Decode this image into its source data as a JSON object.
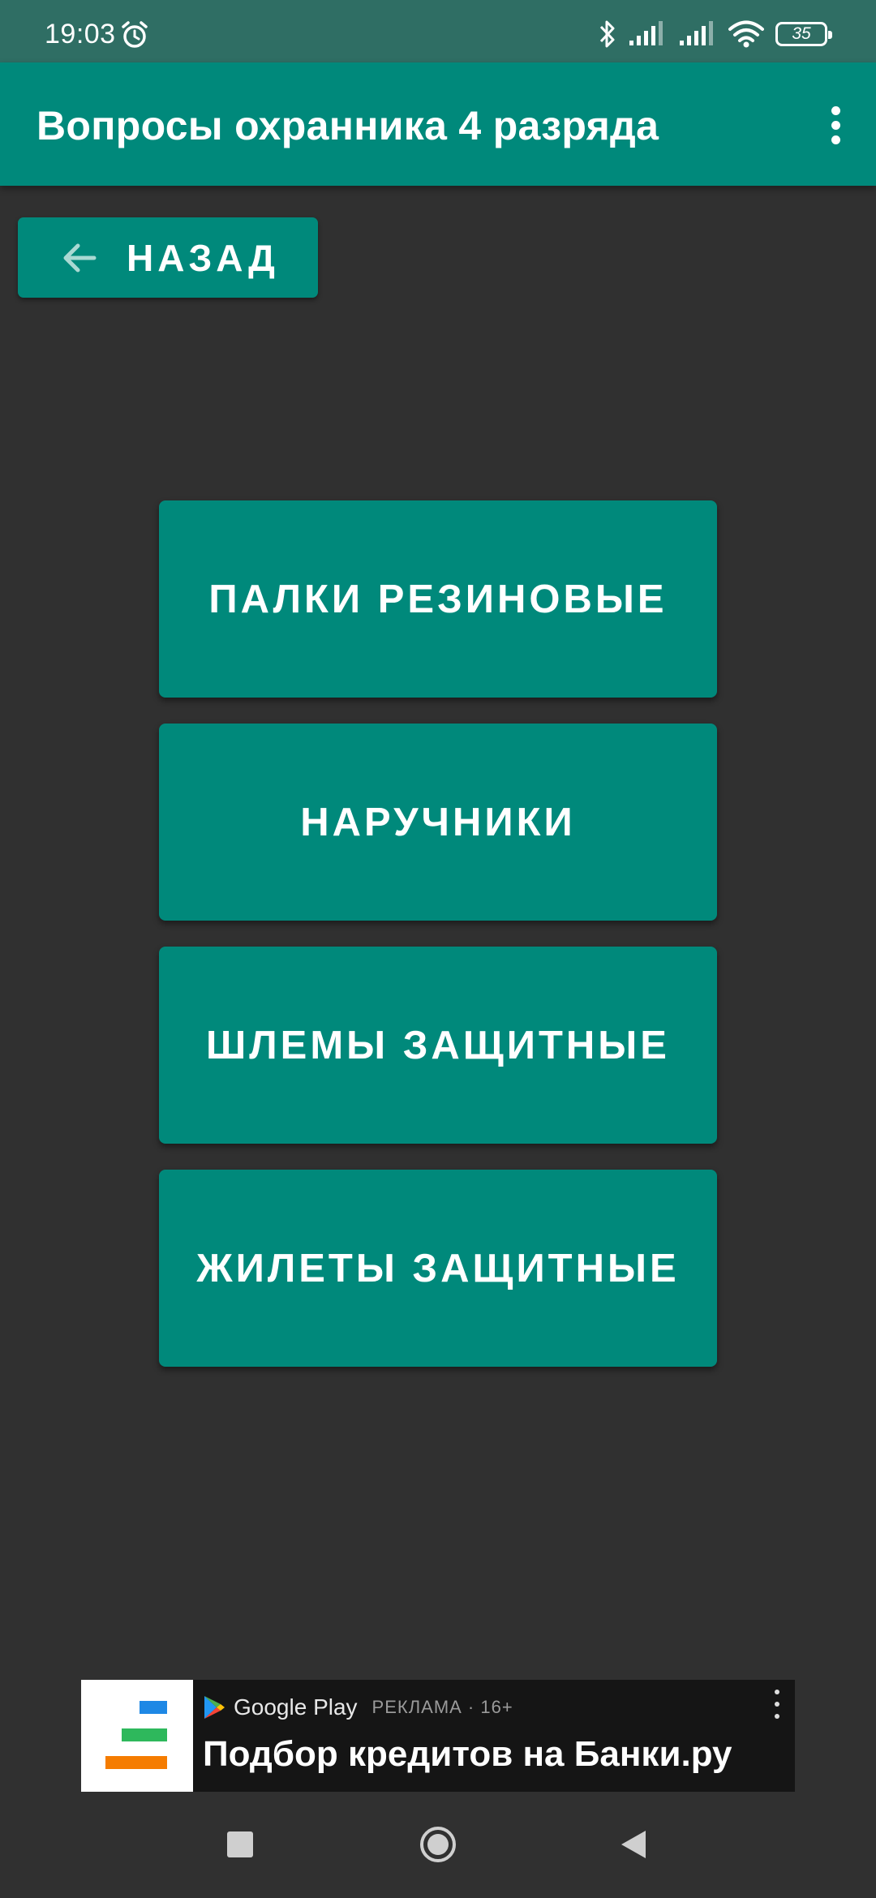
{
  "status_bar": {
    "time": "19:03",
    "battery": "35",
    "icons": [
      "alarm-icon",
      "bluetooth-icon",
      "signal-icon",
      "signal-icon",
      "wifi-icon",
      "battery-icon"
    ]
  },
  "app_bar": {
    "title": "Вопросы охранника 4 разряда",
    "menu_icon": "overflow-menu-icon"
  },
  "back_button": {
    "label": "НАЗАД",
    "icon": "arrow-left-icon"
  },
  "categories": [
    {
      "label": "ПАЛКИ РЕЗИНОВЫЕ"
    },
    {
      "label": "НАРУЧНИКИ"
    },
    {
      "label": "ШЛЕМЫ ЗАЩИТНЫЕ"
    },
    {
      "label": "ЖИЛЕТЫ ЗАЩИТНЫЕ"
    }
  ],
  "ad": {
    "store": "Google Play",
    "meta": "РЕКЛАМА · 16+",
    "headline": "Подбор кредитов на Банки.ру",
    "logo_colors": [
      "#1e88e5",
      "#2eb85c",
      "#f57c00"
    ]
  },
  "nav_bar": {
    "icons": [
      "recent-apps-icon",
      "home-icon",
      "back-icon"
    ]
  },
  "colors": {
    "primary": "#00897b",
    "status_bar": "#2f6e64",
    "background": "#303030"
  }
}
